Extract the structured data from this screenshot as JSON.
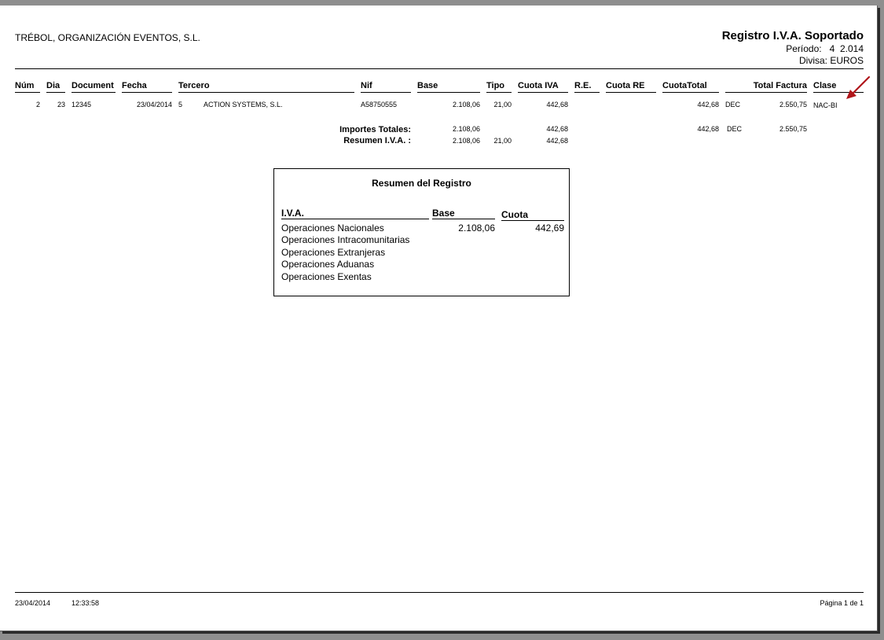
{
  "header": {
    "company": "TRÉBOL, ORGANIZACIÓN EVENTOS, S.L.",
    "title": "Registro I.V.A. Soportado",
    "period_label": "Período:",
    "period_value": "4  2.014",
    "currency": "Divisa: EUROS"
  },
  "columns": {
    "num": "Núm",
    "dia": "Dia",
    "document": "Document",
    "fecha": "Fecha",
    "tercero": "Tercero",
    "nif": "Nif",
    "base": "Base",
    "tipo": "Tipo",
    "cuota_iva": "Cuota IVA",
    "re": "R.E.",
    "cuota_re": "Cuota RE",
    "cuota_total": "CuotaTotal",
    "total_factura": "Total Factura",
    "clase": "Clase"
  },
  "rows": [
    {
      "num": "2",
      "dia": "23",
      "document": "12345",
      "fecha": "23/04/2014",
      "tercero_code": "5",
      "tercero_name": "ACTION SYSTEMS, S.L.",
      "nif": "A58750555",
      "base": "2.108,06",
      "tipo": "21,00",
      "cuota_iva": "442,68",
      "cuota_total": "442,68",
      "dec": "DEC",
      "total_factura": "2.550,75",
      "clase": "NAC-BI"
    }
  ],
  "totals": {
    "importes_label": "Importes Totales:",
    "importes_base": "2.108,06",
    "importes_cuota_iva": "442,68",
    "importes_cuota_total": "442,68",
    "importes_dec": "DEC",
    "importes_total_factura": "2.550,75",
    "resumen_label": "Resumen I.V.A. :",
    "resumen_base": "2.108,06",
    "resumen_tipo": "21,00",
    "resumen_cuota": "442,68"
  },
  "summary": {
    "title": "Resumen del Registro",
    "col_iva": "I.V.A.",
    "col_base": "Base",
    "col_cuota": "Cuota",
    "rows": [
      {
        "label": "Operaciones Nacionales",
        "base": "2.108,06",
        "cuota": "442,69"
      },
      {
        "label": "Operaciones Intracomunitarias"
      },
      {
        "label": "Operaciones Extranjeras"
      },
      {
        "label": "Operaciones Aduanas"
      },
      {
        "label": "Operaciones Exentas"
      }
    ]
  },
  "footer": {
    "date": "23/04/2014",
    "time": "12:33:58",
    "page": "Página 1 de 1"
  },
  "colors": {
    "arrow": "#b0161b",
    "viewer_background": "#8e8e8e"
  }
}
